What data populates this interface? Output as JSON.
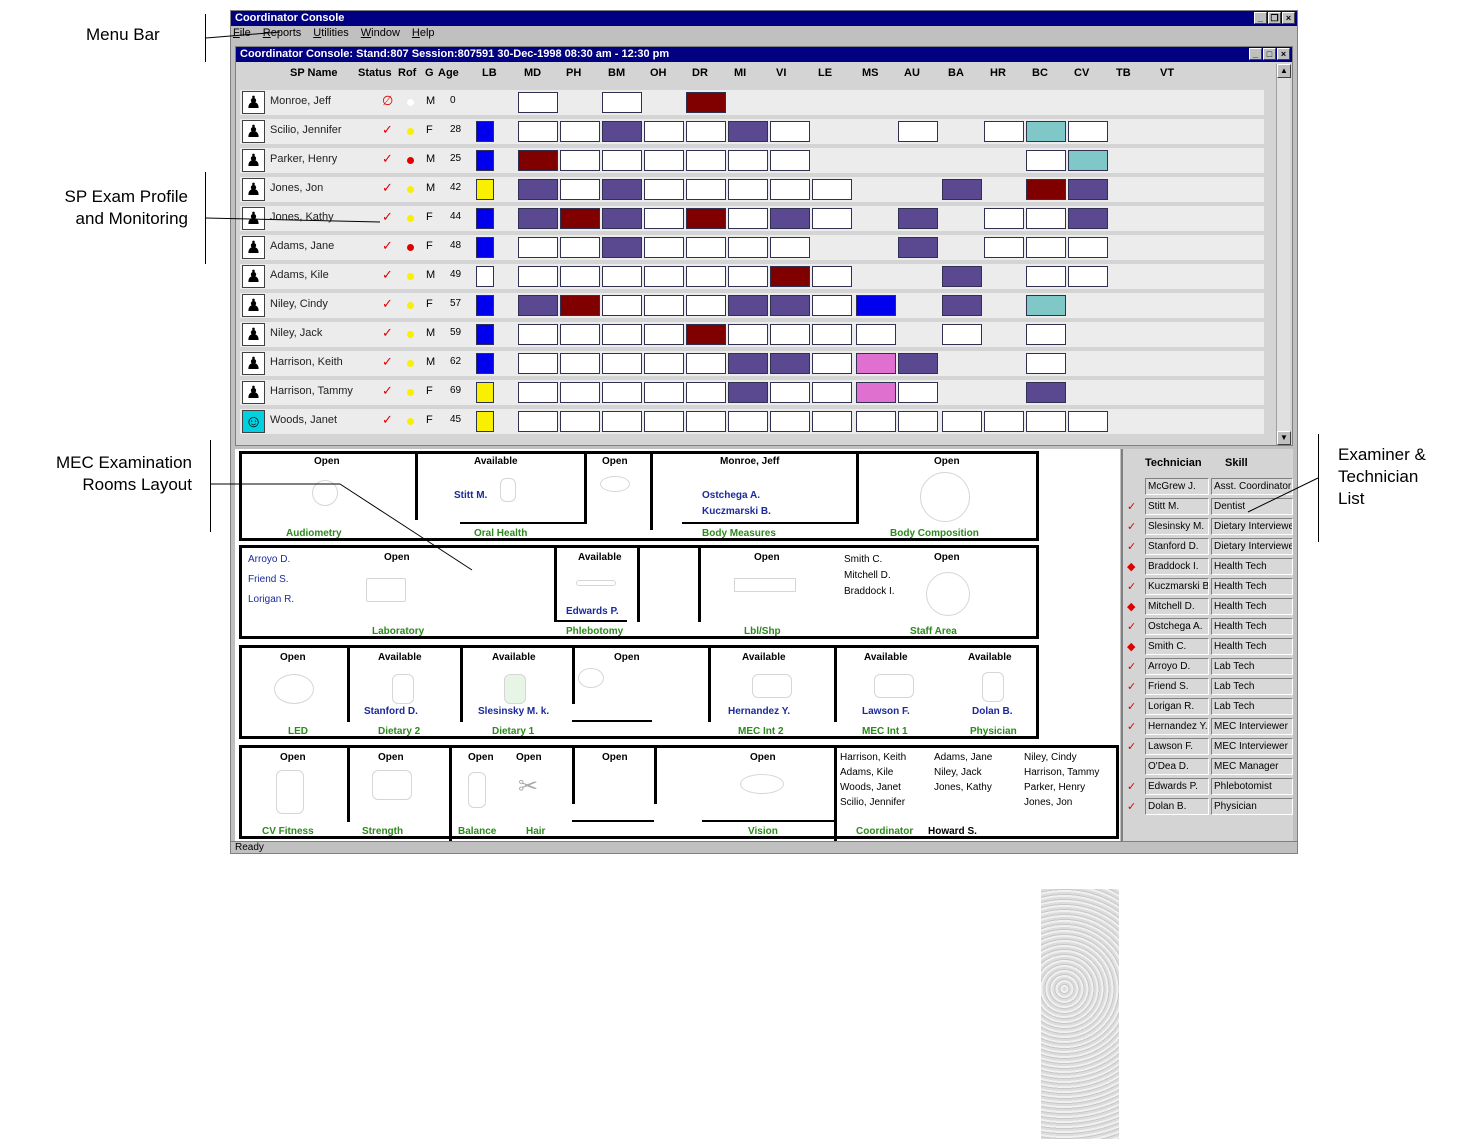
{
  "annotations": {
    "menu_bar": "Menu Bar",
    "sp_profile_1": "SP Exam Profile",
    "sp_profile_2": "and Monitoring",
    "mec_rooms_1": "MEC Examination",
    "mec_rooms_2": "Rooms Layout",
    "examiner_1": "Examiner &",
    "examiner_2": "Technician",
    "examiner_3": "List"
  },
  "app": {
    "title": "Coordinator Console",
    "menu": [
      "File",
      "Reports",
      "Utilities",
      "Window",
      "Help"
    ],
    "status": "Ready"
  },
  "child": {
    "title": "Coordinator Console: Stand:807 Session:807591 30-Dec-1998 08:30 am - 12:30 pm"
  },
  "columns": {
    "sp_name": "SP Name",
    "status": "Status",
    "rof": "Rof",
    "g": "G",
    "age": "Age",
    "exams": [
      "LB",
      "MD",
      "PH",
      "BM",
      "OH",
      "DR",
      "MI",
      "VI",
      "LE",
      "MS",
      "AU",
      "BA",
      "HR",
      "BC",
      "CV",
      "TB",
      "VT"
    ]
  },
  "colors": {
    "white": "#ffffff",
    "purple": "#5a4890",
    "maroon": "#800000",
    "blue": "#0000ee",
    "yellow": "#f8f000",
    "teal": "#80c8c8",
    "pink": "#e070d0",
    "dot_yellow": "#f8f000",
    "dot_red": "#e00000",
    "dot_white": "#ffffff"
  },
  "participants": [
    {
      "name": "Monroe, Jeff",
      "status": "∅",
      "dot": "dot_white",
      "g": "M",
      "age": "0",
      "cells": {
        "MD": "white",
        "BM": "white",
        "DR": "maroon"
      }
    },
    {
      "name": "Scilio, Jennifer",
      "status": "✓",
      "dot": "dot_yellow",
      "g": "F",
      "age": "28",
      "cells": {
        "LB": "blue",
        "MD": "white",
        "PH": "white",
        "BM": "purple",
        "OH": "white",
        "DR": "white",
        "MI": "purple",
        "VI": "white",
        "AU": "white",
        "HR": "white",
        "BC": "teal",
        "CV": "white"
      }
    },
    {
      "name": "Parker, Henry",
      "status": "✓",
      "dot": "dot_red",
      "g": "M",
      "age": "25",
      "cells": {
        "LB": "blue",
        "MD": "maroon",
        "PH": "white",
        "BM": "white",
        "OH": "white",
        "DR": "white",
        "MI": "white",
        "VI": "white",
        "BC": "white",
        "CV": "teal"
      }
    },
    {
      "name": "Jones, Jon",
      "status": "✓",
      "dot": "dot_yellow",
      "g": "M",
      "age": "42",
      "cells": {
        "LB": "yellow",
        "MD": "purple",
        "PH": "white",
        "BM": "purple",
        "OH": "white",
        "DR": "white",
        "MI": "white",
        "VI": "white",
        "LE": "white",
        "BA": "purple",
        "BC": "maroon",
        "CV": "purple"
      }
    },
    {
      "name": "Jones, Kathy",
      "status": "✓",
      "dot": "dot_yellow",
      "g": "F",
      "age": "44",
      "cells": {
        "LB": "blue",
        "MD": "purple",
        "PH": "maroon",
        "BM": "purple",
        "OH": "white",
        "DR": "maroon",
        "MI": "white",
        "VI": "purple",
        "LE": "white",
        "AU": "purple",
        "HR": "white",
        "BC": "white",
        "CV": "purple"
      }
    },
    {
      "name": "Adams, Jane",
      "status": "✓",
      "dot": "dot_red",
      "g": "F",
      "age": "48",
      "cells": {
        "LB": "blue",
        "MD": "white",
        "PH": "white",
        "BM": "purple",
        "OH": "white",
        "DR": "white",
        "MI": "white",
        "VI": "white",
        "AU": "purple",
        "HR": "white",
        "BC": "white",
        "CV": "white"
      }
    },
    {
      "name": "Adams, Kile",
      "status": "✓",
      "dot": "dot_yellow",
      "g": "M",
      "age": "49",
      "cells": {
        "LB": "white",
        "MD": "white",
        "PH": "white",
        "BM": "white",
        "OH": "white",
        "DR": "white",
        "MI": "white",
        "VI": "maroon",
        "LE": "white",
        "BA": "purple",
        "BC": "white",
        "CV": "white"
      }
    },
    {
      "name": "Niley, Cindy",
      "status": "✓",
      "dot": "dot_yellow",
      "g": "F",
      "age": "57",
      "cells": {
        "LB": "blue",
        "MD": "purple",
        "PH": "maroon",
        "BM": "white",
        "OH": "white",
        "DR": "white",
        "MI": "purple",
        "VI": "purple",
        "LE": "white",
        "MS": "blue",
        "BA": "purple",
        "BC": "teal"
      }
    },
    {
      "name": "Niley, Jack",
      "status": "✓",
      "dot": "dot_yellow",
      "g": "M",
      "age": "59",
      "cells": {
        "LB": "blue",
        "MD": "white",
        "PH": "white",
        "BM": "white",
        "OH": "white",
        "DR": "maroon",
        "MI": "white",
        "VI": "white",
        "LE": "white",
        "MS": "white",
        "BA": "white",
        "BC": "white"
      }
    },
    {
      "name": "Harrison, Keith",
      "status": "✓",
      "dot": "dot_yellow",
      "g": "M",
      "age": "62",
      "cells": {
        "LB": "blue",
        "MD": "white",
        "PH": "white",
        "BM": "white",
        "OH": "white",
        "DR": "white",
        "MI": "purple",
        "VI": "purple",
        "LE": "white",
        "MS": "pink",
        "AU": "purple",
        "BC": "white"
      }
    },
    {
      "name": "Harrison, Tammy",
      "status": "✓",
      "dot": "dot_yellow",
      "g": "F",
      "age": "69",
      "cells": {
        "LB": "yellow",
        "MD": "white",
        "PH": "white",
        "BM": "white",
        "OH": "white",
        "DR": "white",
        "MI": "purple",
        "VI": "white",
        "LE": "white",
        "MS": "pink",
        "AU": "white",
        "BC": "purple"
      }
    },
    {
      "name": "Woods, Janet",
      "status": "✓",
      "dot": "dot_yellow",
      "g": "F",
      "age": "45",
      "cells": {
        "LB": "yellow",
        "MD": "white",
        "PH": "white",
        "BM": "white",
        "OH": "white",
        "DR": "white",
        "MI": "white",
        "VI": "white",
        "LE": "white",
        "MS": "white",
        "AU": "white",
        "BA": "white",
        "HR": "white",
        "BC": "white",
        "CV": "white"
      }
    }
  ],
  "rooms": {
    "audiometry": {
      "status": "Open",
      "label": "Audiometry"
    },
    "oral_health": {
      "status": "Available",
      "label": "Oral Health",
      "staff": "Stitt M."
    },
    "oh_open": {
      "status": "Open"
    },
    "body_measures": {
      "status": "Monroe, Jeff",
      "label": "Body Measures",
      "staff1": "Ostchega A.",
      "staff2": "Kuczmarski B."
    },
    "body_comp": {
      "status": "Open",
      "label": "Body Composition"
    },
    "laboratory": {
      "status": "Open",
      "label": "Laboratory",
      "p1": "Arroyo D.",
      "p2": "Friend S.",
      "p3": "Lorigan R."
    },
    "phlebotomy": {
      "status": "Available",
      "label": "Phlebotomy",
      "staff": "Edwards P."
    },
    "lbl_shp": {
      "status": "Open",
      "label": "Lbl/Shp"
    },
    "staff_area": {
      "status": "Open",
      "label": "Staff Area",
      "p1": "Smith C.",
      "p2": "Mitchell D.",
      "p3": "Braddock I."
    },
    "led": {
      "status": "Open",
      "label": "LED"
    },
    "dietary2": {
      "status": "Available",
      "label": "Dietary 2",
      "staff": "Stanford D."
    },
    "dietary1": {
      "status": "Available",
      "label": "Dietary 1",
      "staff": "Slesinsky M. k."
    },
    "d_open": {
      "status": "Open"
    },
    "mec_int2": {
      "status": "Available",
      "label": "MEC Int 2",
      "staff": "Hernandez Y."
    },
    "mec_int1": {
      "status": "Available",
      "label": "MEC Int 1",
      "staff": "Lawson F."
    },
    "physician": {
      "status": "Available",
      "label": "Physician",
      "staff": "Dolan B."
    },
    "cv_fitness": {
      "status": "Open",
      "label": "CV Fitness"
    },
    "strength": {
      "status": "Open",
      "label": "Strength"
    },
    "balance": {
      "status": "Open",
      "label": "Balance"
    },
    "hair": {
      "status": "Open",
      "label": "Hair"
    },
    "b_open": {
      "status": "Open"
    },
    "vision": {
      "status": "Open",
      "label": "Vision"
    },
    "coordinator": {
      "label": "Coordinator",
      "staff": "Howard S.",
      "names": [
        "Harrison, Keith",
        "Adams, Jane",
        "Niley, Cindy",
        "Adams, Kile",
        "Niley, Jack",
        "Harrison, Tammy",
        "Woods, Janet",
        "Jones, Kathy",
        "Parker, Henry",
        "Scilio, Jennifer",
        "Jones, Jon"
      ]
    }
  },
  "techs": {
    "header_tech": "Technician",
    "header_skill": "Skill",
    "list": [
      {
        "check": "",
        "name": "McGrew J.",
        "skill": "Asst. Coordinator"
      },
      {
        "check": "✓",
        "name": "Stitt M.",
        "skill": "Dentist"
      },
      {
        "check": "✓",
        "name": "Slesinsky M.",
        "skill": "Dietary Interviewer"
      },
      {
        "check": "✓",
        "name": "Stanford D.",
        "skill": "Dietary Interviewer"
      },
      {
        "check": "◆",
        "name": "Braddock I.",
        "skill": "Health Tech"
      },
      {
        "check": "✓",
        "name": "Kuczmarski B.",
        "skill": "Health Tech"
      },
      {
        "check": "◆",
        "name": "Mitchell D.",
        "skill": "Health Tech"
      },
      {
        "check": "✓",
        "name": "Ostchega A.",
        "skill": "Health Tech"
      },
      {
        "check": "◆",
        "name": "Smith C.",
        "skill": "Health Tech"
      },
      {
        "check": "✓",
        "name": "Arroyo D.",
        "skill": "Lab Tech"
      },
      {
        "check": "✓",
        "name": "Friend S.",
        "skill": "Lab Tech"
      },
      {
        "check": "✓",
        "name": "Lorigan R.",
        "skill": "Lab Tech"
      },
      {
        "check": "✓",
        "name": "Hernandez Y.",
        "skill": "MEC Interviewer"
      },
      {
        "check": "✓",
        "name": "Lawson F.",
        "skill": "MEC Interviewer"
      },
      {
        "check": "",
        "name": "O'Dea D.",
        "skill": "MEC Manager"
      },
      {
        "check": "✓",
        "name": "Edwards P.",
        "skill": "Phlebotomist"
      },
      {
        "check": "✓",
        "name": "Dolan B.",
        "skill": "Physician"
      }
    ]
  }
}
